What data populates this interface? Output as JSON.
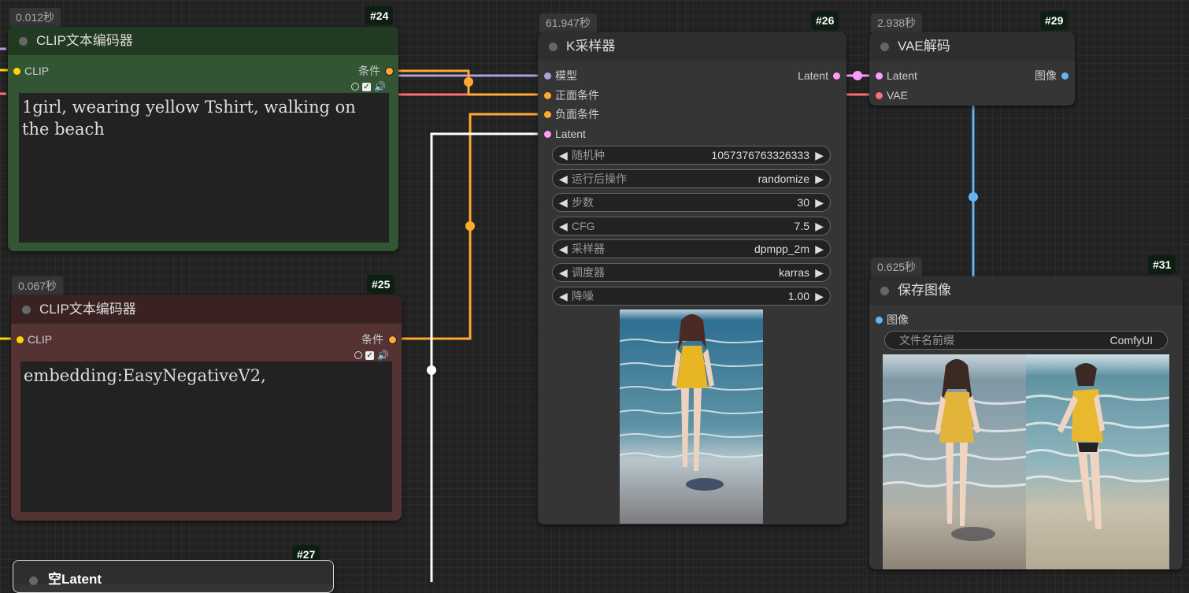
{
  "nodes": {
    "clip_pos": {
      "timer": "0.012秒",
      "id": "#24",
      "title": "CLIP文本编码器",
      "input_clip": "CLIP",
      "output_cond": "条件",
      "text": "1girl, wearing yellow Tshirt, walking on the beach",
      "check_mark": "✓",
      "speaker": "🔊"
    },
    "clip_neg": {
      "timer": "0.067秒",
      "id": "#25",
      "title": "CLIP文本编码器",
      "input_clip": "CLIP",
      "output_cond": "条件",
      "text": "embedding:EasyNegativeV2,",
      "check_mark": "✓",
      "speaker": "🔊"
    },
    "empty_latent": {
      "id": "#27",
      "title": "空Latent"
    },
    "ksampler": {
      "timer": "61.947秒",
      "id": "#26",
      "title": "K采样器",
      "inputs": [
        "模型",
        "正面条件",
        "负面条件",
        "Latent"
      ],
      "output": "Latent",
      "arrow_left": "◀",
      "arrow_right": "▶",
      "widgets": [
        {
          "label": "随机种",
          "value": "1057376763326333"
        },
        {
          "label": "运行后操作",
          "value": "randomize"
        },
        {
          "label": "步数",
          "value": "30"
        },
        {
          "label": "CFG",
          "value": "7.5"
        },
        {
          "label": "采样器",
          "value": "dpmpp_2m"
        },
        {
          "label": "调度器",
          "value": "karras"
        },
        {
          "label": "降噪",
          "value": "1.00"
        }
      ]
    },
    "vae_decode": {
      "timer": "2.938秒",
      "id": "#29",
      "title": "VAE解码",
      "inputs": [
        "Latent",
        "VAE"
      ],
      "output": "图像"
    },
    "save_image": {
      "timer": "0.625秒",
      "id": "#31",
      "title": "保存图像",
      "input": "图像",
      "prefix_label": "文件名前缀",
      "prefix_value": "ComfyUI"
    }
  },
  "colors": {
    "clip_yellow": "#ffd500",
    "cond_orange": "#ffa931",
    "model_lavender": "#b39ddb",
    "vae_red": "#ff6e6e",
    "latent_pink": "#ff9cf9",
    "image_blue": "#64b5f6",
    "positive_node_bg": "#335533",
    "negative_node_bg": "#553333"
  }
}
